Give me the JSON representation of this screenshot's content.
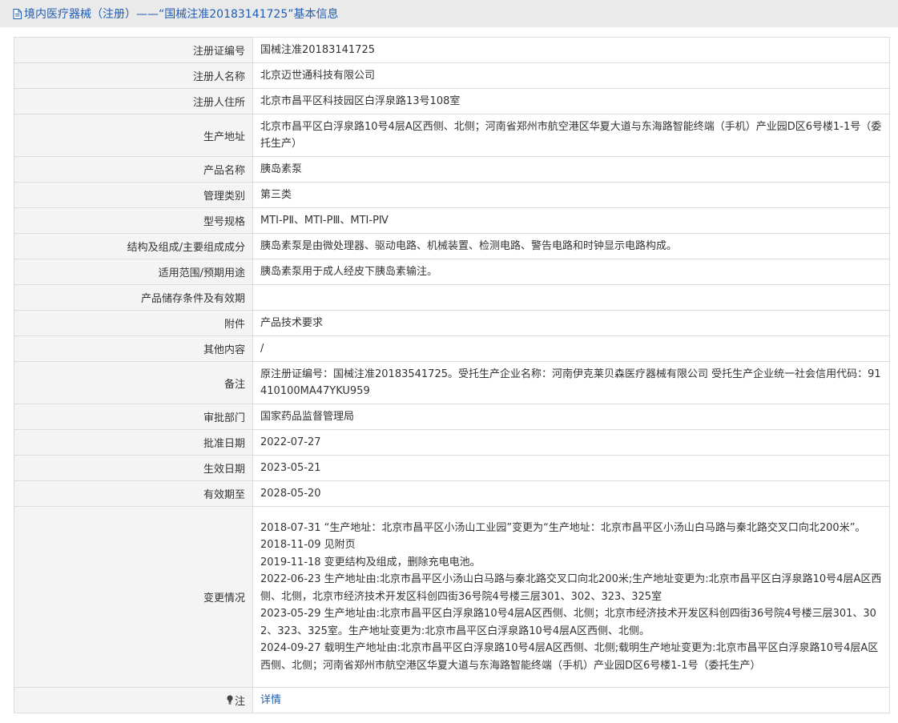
{
  "header": {
    "link_text": "境内医疗器械（注册）",
    "title_suffix": "——“国械注准20183141725”基本信息",
    "icon": "document-icon",
    "color": "#1f5db2"
  },
  "rows": [
    {
      "label": "注册证编号",
      "value": "国械注准20183141725"
    },
    {
      "label": "注册人名称",
      "value": "北京迈世通科技有限公司"
    },
    {
      "label": "注册人住所",
      "value": "北京市昌平区科技园区白浮泉路13号108室"
    },
    {
      "label": "生产地址",
      "value": "北京市昌平区白浮泉路10号4层A区西侧、北侧；河南省郑州市航空港区华夏大道与东海路智能终端（手机）产业园D区6号楼1-1号（委托生产）"
    },
    {
      "label": "产品名称",
      "value": "胰岛素泵"
    },
    {
      "label": "管理类别",
      "value": "第三类"
    },
    {
      "label": "型号规格",
      "value": "MTI-PⅡ、MTI-PⅢ、MTI-PⅣ"
    },
    {
      "label": "结构及组成/主要组成成分",
      "value": "胰岛素泵是由微处理器、驱动电路、机械装置、检测电路、警告电路和时钟显示电路构成。"
    },
    {
      "label": "适用范围/预期用途",
      "value": "胰岛素泵用于成人经皮下胰岛素输注。"
    },
    {
      "label": "产品储存条件及有效期",
      "value": ""
    },
    {
      "label": "附件",
      "value": "产品技术要求"
    },
    {
      "label": "其他内容",
      "value": "/"
    },
    {
      "label": "备注",
      "value": "原注册证编号：国械注准20183541725。受托生产企业名称：河南伊克莱贝森医疗器械有限公司 受托生产企业统一社会信用代码：91410100MA47YKU959"
    },
    {
      "label": "审批部门",
      "value": "国家药品监督管理局"
    },
    {
      "label": "批准日期",
      "value": "2022-07-27"
    },
    {
      "label": "生效日期",
      "value": "2023-05-21"
    },
    {
      "label": "有效期至",
      "value": "2028-05-20"
    }
  ],
  "changes": {
    "label": "变更情况",
    "entries": [
      "2018-07-31 “生产地址：北京市昌平区小汤山工业园”变更为“生产地址：北京市昌平区小汤山白马路与秦北路交叉口向北200米”。",
      "2018-11-09 见附页",
      "2019-11-18 变更结构及组成，删除充电电池。",
      "2022-06-23 生产地址由:北京市昌平区小汤山白马路与秦北路交叉口向北200米;生产地址变更为:北京市昌平区白浮泉路10号4层A区西侧、北侧，北京市经济技术开发区科创四街36号院4号楼三层301、302、323、325室",
      "2023-05-29 生产地址由:北京市昌平区白浮泉路10号4层A区西侧、北侧；北京市经济技术开发区科创四街36号院4号楼三层301、302、323、325室。生产地址变更为:北京市昌平区白浮泉路10号4层A区西侧、北侧。",
      "2024-09-27 载明生产地址由:北京市昌平区白浮泉路10号4层A区西侧、北侧;载明生产地址变更为:北京市昌平区白浮泉路10号4层A区西侧、北侧；河南省郑州市航空港区华夏大道与东海路智能终端（手机）产业园D区6号楼1-1号（委托生产）"
    ]
  },
  "note": {
    "label": "注",
    "icon": "lightbulb-icon",
    "link_text": "详情"
  }
}
